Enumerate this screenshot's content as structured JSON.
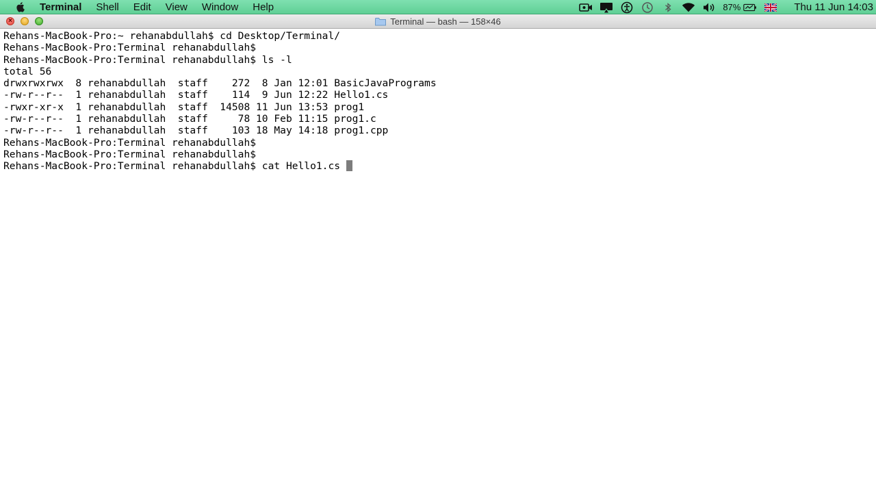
{
  "menubar": {
    "app_name": "Terminal",
    "items": [
      "Shell",
      "Edit",
      "View",
      "Window",
      "Help"
    ],
    "status": {
      "icons": [
        "screen-recorder-icon",
        "airplay-icon",
        "accessibility-icon",
        "time-machine-icon",
        "bluetooth-icon",
        "wifi-icon",
        "volume-icon"
      ],
      "battery_percent": "87%",
      "clock": "Thu 11 Jun  14:03"
    },
    "color": "#6fd8a2"
  },
  "window": {
    "title": "Terminal — bash — 158×46"
  },
  "terminal": {
    "lines": [
      "Rehans-MacBook-Pro:~ rehanabdullah$ cd Desktop/Terminal/",
      "Rehans-MacBook-Pro:Terminal rehanabdullah$",
      "Rehans-MacBook-Pro:Terminal rehanabdullah$ ls -l",
      "total 56",
      "drwxrwxrwx  8 rehanabdullah  staff    272  8 Jan 12:01 BasicJavaPrograms",
      "-rw-r--r--  1 rehanabdullah  staff    114  9 Jun 12:22 Hello1.cs",
      "-rwxr-xr-x  1 rehanabdullah  staff  14508 11 Jun 13:53 prog1",
      "-rw-r--r--  1 rehanabdullah  staff     78 10 Feb 11:15 prog1.c",
      "-rw-r--r--  1 rehanabdullah  staff    103 18 May 14:18 prog1.cpp",
      "Rehans-MacBook-Pro:Terminal rehanabdullah$",
      "Rehans-MacBook-Pro:Terminal rehanabdullah$"
    ],
    "current_line": "Rehans-MacBook-Pro:Terminal rehanabdullah$ cat Hello1.cs "
  }
}
